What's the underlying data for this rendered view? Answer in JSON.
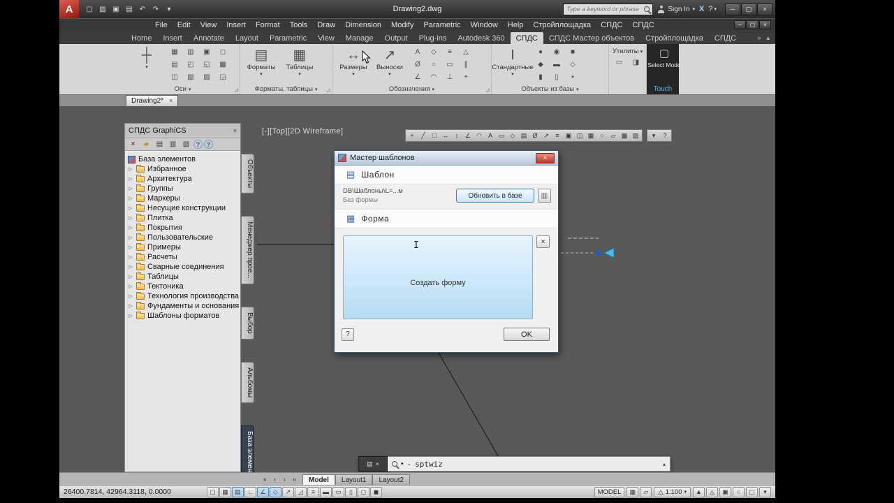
{
  "icons": {
    "dropdown": "▾",
    "expand": "▷",
    "launcher": "◿",
    "overflow": "»",
    "ribbon_minimize": "▴"
  },
  "titlebar": {
    "app_initial": "A",
    "qat": [
      {
        "name": "new-file-icon",
        "glyph": "▢"
      },
      {
        "name": "open-file-icon",
        "glyph": "▨"
      },
      {
        "name": "save-icon",
        "glyph": "▣"
      },
      {
        "name": "plot-icon",
        "glyph": "▤"
      },
      {
        "name": "undo-icon",
        "glyph": "↶"
      },
      {
        "name": "redo-icon",
        "glyph": "↷"
      },
      {
        "name": "qat-dropdown-icon",
        "glyph": "▾"
      }
    ],
    "title": "Drawing2.dwg",
    "search_placeholder": "Type a keyword or phrase",
    "signin_label": "Sign In",
    "exchange_label": "X",
    "help_label": "?",
    "window_buttons": [
      {
        "name": "minimize-button",
        "glyph": "─"
      },
      {
        "name": "restore-button",
        "glyph": "▢"
      },
      {
        "name": "close-button",
        "glyph": "×"
      }
    ]
  },
  "menubar": {
    "items": [
      "File",
      "Edit",
      "View",
      "Insert",
      "Format",
      "Tools",
      "Draw",
      "Dimension",
      "Modify",
      "Parametric",
      "Window",
      "Help",
      "Стройплощадка",
      "СПДС",
      "СПДС"
    ],
    "mdi_buttons": [
      {
        "name": "mdi-minimize-button",
        "glyph": "─"
      },
      {
        "name": "mdi-restore-button",
        "glyph": "▢"
      },
      {
        "name": "mdi-close-button",
        "glyph": "×"
      }
    ]
  },
  "ribbon": {
    "tabs": [
      {
        "label": "Home"
      },
      {
        "label": "Insert"
      },
      {
        "label": "Annotate"
      },
      {
        "label": "Layout"
      },
      {
        "label": "Parametric"
      },
      {
        "label": "View"
      },
      {
        "label": "Manage"
      },
      {
        "label": "Output"
      },
      {
        "label": "Plug-ins"
      },
      {
        "label": "Autodesk 360"
      },
      {
        "label": "СПДС",
        "state": "active"
      },
      {
        "label": "СПДС Мастер объектов"
      },
      {
        "label": "Стройплощадка"
      },
      {
        "label": "СПДС"
      }
    ],
    "panels": {
      "osi": {
        "label": "Оси",
        "big_glyph": "┼",
        "small": [
          "▦",
          "▤",
          "◫",
          "▥",
          "◰",
          "▧",
          "▣",
          "◱",
          "▨",
          "◻",
          "▩",
          "◲"
        ]
      },
      "formats": {
        "label": "Форматы, таблицы",
        "buttons": [
          {
            "glyph": "▤",
            "label": "Форматы"
          },
          {
            "glyph": "▦",
            "label": "Таблицы"
          }
        ]
      },
      "oboz": {
        "label": "Обозначения",
        "buttons": [
          {
            "glyph": "↔",
            "label": "Размеры"
          },
          {
            "glyph": "↗",
            "label": "Выноски"
          }
        ],
        "small": [
          "A",
          "Ø",
          "∠",
          "◇",
          "○",
          "◠",
          "≡",
          "▭",
          "⊥",
          "△",
          "∥",
          "+"
        ]
      },
      "objects": {
        "label": "Объекты из базы",
        "buttons": [
          {
            "glyph": "Ι",
            "label": "Стандартные"
          }
        ],
        "small": [
          "●",
          "◆",
          "▮",
          "◉",
          "▬",
          "▯",
          "■",
          "◇",
          "▪"
        ]
      },
      "utils": {
        "label": "Утилиты",
        "small": [
          "▭",
          "◨"
        ]
      },
      "touch": {
        "glyph": "▢",
        "button_label": "Select Mode",
        "label": "Touch"
      }
    }
  },
  "doc_tab": {
    "label": "Drawing2*",
    "close_glyph": "×"
  },
  "palette": {
    "title": "СПДС GraphiCS",
    "toolbar": [
      {
        "name": "delete-icon",
        "glyph": "×",
        "cls": "red"
      },
      {
        "name": "open-folder-icon",
        "glyph": "▰",
        "cls": "folder"
      },
      {
        "name": "new-object-icon",
        "glyph": "▤"
      },
      {
        "name": "thumbnails-icon",
        "glyph": "▥"
      },
      {
        "name": "preview-icon",
        "glyph": "▧"
      },
      {
        "name": "notes-icon",
        "glyph": "?",
        "cls": "help"
      },
      {
        "name": "help-icon",
        "glyph": "?",
        "cls": "help"
      }
    ],
    "root_label": "База элементов",
    "items": [
      "Избранное",
      "Архитектура",
      "Группы",
      "Маркеры",
      "Несущие конструкции",
      "Плитка",
      "Покрытия",
      "Пользовательские",
      "Примеры",
      "Расчеты",
      "Сварные соединения",
      "Таблицы",
      "Тектоника",
      "Технология производства",
      "Фундаменты и основания",
      "Шаблоны форматов"
    ],
    "tabs": [
      {
        "label": "Объекты"
      },
      {
        "label": "Менеджер прое..."
      },
      {
        "label": "Выбор"
      },
      {
        "label": "Альбомы"
      },
      {
        "label": "База элементов",
        "state": "active"
      }
    ]
  },
  "canvas": {
    "viewport_controls": "[-][Top][2D Wireframe]",
    "toolbar": [
      "+",
      "╱",
      "□",
      "↔",
      "↕",
      "∠",
      "◠",
      "A",
      "▭",
      "◇",
      "▤",
      "Ø",
      "↗",
      "≡",
      "▣",
      "◫",
      "▦",
      "○",
      "▱",
      "▩",
      "▨"
    ],
    "toolbar_extra": [
      "▾",
      "?"
    ]
  },
  "dialog": {
    "title": "Мастер шаблонов",
    "close_glyph": "×",
    "template_section": {
      "label": "Шаблон",
      "path": "DB\\Шаблоны\\L=...м",
      "status": "Без формы",
      "update_button": "Обновить в базе"
    },
    "form_section": {
      "label": "Форма",
      "create_label": "Создать форму",
      "close_glyph": "×"
    },
    "help_button": "?",
    "ok_button": "OK"
  },
  "command": {
    "grip_glyph": "▤",
    "close_glyph": "×",
    "dropdown_glyph": "▾",
    "prompt": "-",
    "text": "sptwiz",
    "expand_glyph": "▴"
  },
  "layout_tabs": {
    "nav": [
      "«",
      "‹",
      "›",
      "»"
    ],
    "tabs": [
      {
        "label": "Model",
        "state": "active"
      },
      {
        "label": "Layout1"
      },
      {
        "label": "Layout2"
      }
    ]
  },
  "statusbar": {
    "coords": "26400.7814, 42964.3118, 0.0000",
    "toggles": [
      {
        "name": "infer-constraints-icon",
        "glyph": "▢"
      },
      {
        "name": "snap-icon",
        "glyph": "▦"
      },
      {
        "name": "grid-icon",
        "glyph": "▤",
        "state": "active"
      },
      {
        "name": "ortho-icon",
        "glyph": "∟"
      },
      {
        "name": "polar-icon",
        "glyph": "∠",
        "state": "active"
      },
      {
        "name": "osnap-icon",
        "glyph": "◇",
        "state": "active"
      },
      {
        "name": "otrack-icon",
        "glyph": "↗"
      },
      {
        "name": "ducs-icon",
        "glyph": "◿"
      },
      {
        "name": "dyn-icon",
        "glyph": "≡"
      },
      {
        "name": "lwt-icon",
        "glyph": "▬"
      },
      {
        "name": "transparency-icon",
        "glyph": "▭"
      },
      {
        "name": "quick-properties-icon",
        "glyph": "▯"
      },
      {
        "name": "selection-cycling-icon",
        "glyph": "◻"
      },
      {
        "name": "annotation-monitor-icon",
        "glyph": "◼"
      }
    ],
    "model_label": "MODEL",
    "space_icons": [
      {
        "name": "model-space-icon",
        "glyph": "▦"
      },
      {
        "name": "paper-space-icon",
        "glyph": "▱"
      }
    ],
    "scale": {
      "icon_glyph": "△",
      "value": "1:100",
      "dropdown": "▾"
    },
    "right_icons": [
      {
        "name": "annotation-visibility-icon",
        "glyph": "▲"
      },
      {
        "name": "autoscale-icon",
        "glyph": "◬"
      },
      {
        "name": "workspace-icon",
        "glyph": "▣"
      },
      {
        "name": "lock-icon",
        "glyph": "○"
      },
      {
        "name": "cleanscreen-icon",
        "glyph": "▢"
      },
      {
        "name": "status-menu-icon",
        "glyph": "▾"
      }
    ]
  }
}
